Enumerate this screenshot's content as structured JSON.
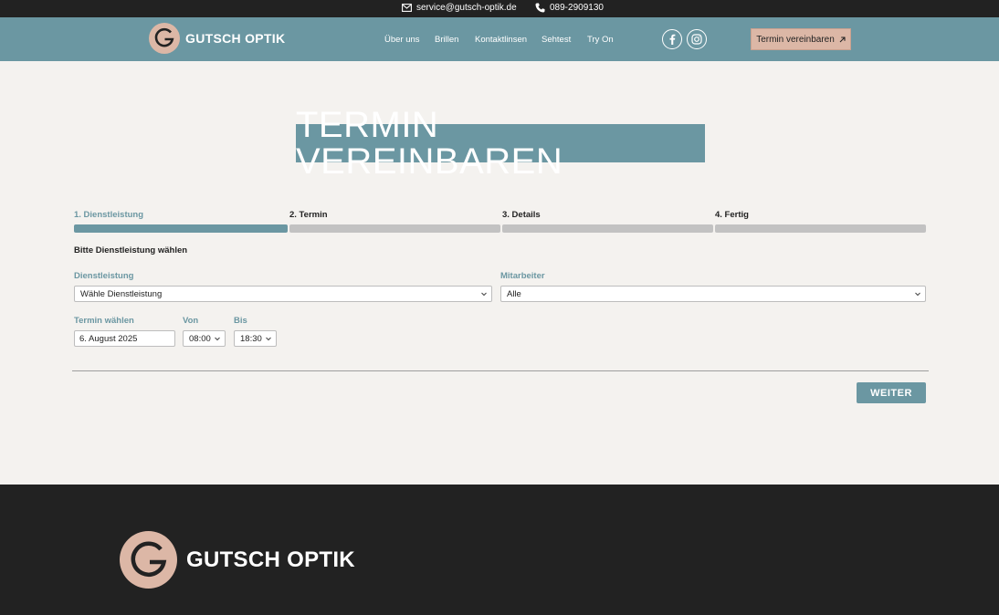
{
  "topbar": {
    "email": "service@gutsch-optik.de",
    "phone": "089-2909130"
  },
  "header": {
    "brand": "GUTSCH OPTIK",
    "nav": [
      "Über uns",
      "Brillen",
      "Kontaktlinsen",
      "Sehtest",
      "Try On"
    ],
    "social": [
      "facebook-icon",
      "instagram-icon"
    ],
    "cta_label": "Termin vereinbaren"
  },
  "hero": {
    "title": "TERMIN VEREINBAREN"
  },
  "steps": [
    {
      "label": "1. Dienstleistung",
      "active": true
    },
    {
      "label": "2. Termin",
      "active": false
    },
    {
      "label": "3. Details",
      "active": false
    },
    {
      "label": "4. Fertig",
      "active": false
    }
  ],
  "form": {
    "subheading": "Bitte Dienstleistung wählen",
    "service_label": "Dienstleistung",
    "service_value": "Wähle Dienstleistung",
    "staff_label": "Mitarbeiter",
    "staff_value": "Alle",
    "date_label": "Termin wählen",
    "date_value": "6. August 2025",
    "from_label": "Von",
    "from_value": "08:00",
    "to_label": "Bis",
    "to_value": "18:30",
    "next_label": "WEITER"
  },
  "footer": {
    "brand": "GUTSCH OPTIK"
  },
  "colors": {
    "accent": "#6b97a2",
    "brand_rose": "#dcb7a6",
    "dark": "#222222",
    "background": "#f4f2ef"
  }
}
